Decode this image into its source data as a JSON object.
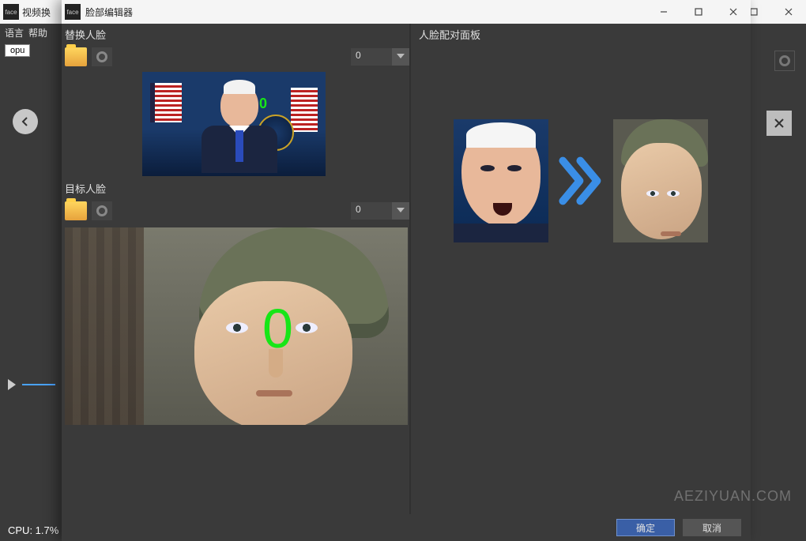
{
  "bg_window": {
    "title": "视频换",
    "menu": {
      "language": "语言",
      "help": "帮助"
    },
    "opu": "opu",
    "cpu_label": "CPU: 1.7%"
  },
  "modal": {
    "title": "脸部编辑器",
    "source_section": "替换人脸",
    "target_section": "目标人脸",
    "source_dd_value": "0",
    "target_dd_value": "0",
    "pair_panel_title": "人脸配对面板",
    "ok": "确定",
    "cancel": "取消",
    "source_marker": "0",
    "target_marker": "0"
  },
  "watermark": "AEZIYUAN.COM"
}
